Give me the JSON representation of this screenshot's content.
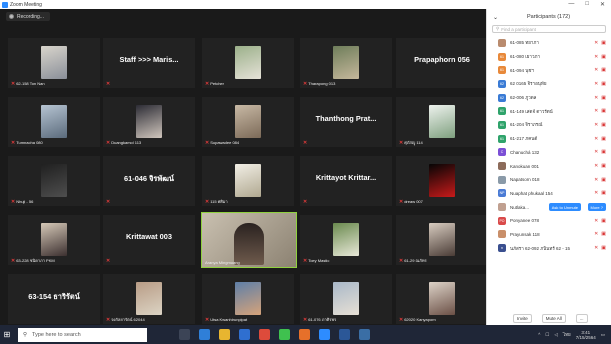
{
  "window": {
    "title": "Zoom Meeting",
    "controls": [
      "—",
      "□",
      "✕"
    ]
  },
  "recording": {
    "label": "Recording..."
  },
  "tiles": [
    {
      "kind": "pic",
      "label": "62-158 Ton Nan",
      "c1": "#d9d5cc",
      "c2": "#8a8f99",
      "muted": true
    },
    {
      "kind": "text",
      "text": "Staff >>> Maris...",
      "label": "",
      "muted": true
    },
    {
      "kind": "pic",
      "label": "Petcher",
      "c1": "#9bb08a",
      "c2": "#e6e2d8",
      "muted": true
    },
    {
      "kind": "pic",
      "label": "Tharapong 013",
      "c1": "#6e7d5a",
      "c2": "#c6b89c",
      "muted": true
    },
    {
      "kind": "text",
      "text": "Prapaphorn 056",
      "label": "",
      "muted": false
    },
    {
      "kind": "pic",
      "label": "Tumnacha 080",
      "c1": "#b6c4d2",
      "c2": "#5b6b7c",
      "muted": true
    },
    {
      "kind": "pic",
      "label": "Duangkamol 113",
      "c1": "#2c2c35",
      "c2": "#d0c6bd",
      "muted": true
    },
    {
      "kind": "pic",
      "label": "Supawadee 084",
      "c1": "#c8b9a5",
      "c2": "#7c6a58",
      "muted": true
    },
    {
      "kind": "text",
      "text": "Thanthong Prat...",
      "label": "",
      "muted": true
    },
    {
      "kind": "pic",
      "label": "ศุภัสญู 114",
      "c1": "#eef2ee",
      "c2": "#7fa07f",
      "muted": true
    },
    {
      "kind": "pic",
      "label": "Nhuji - 56",
      "c1": "#202020",
      "c2": "#4e4e4e",
      "muted": true
    },
    {
      "kind": "text",
      "text": "61-046 จิรพัฒน์",
      "label": "",
      "muted": true
    },
    {
      "kind": "pic",
      "label": "115 ศศิมา",
      "c1": "#f2efe6",
      "c2": "#b0a890",
      "muted": true
    },
    {
      "kind": "text",
      "text": "Krittayot Krittar...",
      "label": "",
      "muted": true
    },
    {
      "kind": "pic",
      "label": "dreaw 007",
      "c1": "#050505",
      "c2": "#c81a1a",
      "muted": true
    },
    {
      "kind": "pic",
      "label": "63-228 ชนิดาภา PKM",
      "c1": "#d6c9b8",
      "c2": "#3c3030",
      "muted": true
    },
    {
      "kind": "text",
      "text": "Krittawat 003",
      "label": "",
      "muted": true
    },
    {
      "kind": "active",
      "label": "Aranya Mingmuang",
      "muted": false
    },
    {
      "kind": "pic",
      "label": "Toey Mastic",
      "c1": "#6a8a4e",
      "c2": "#e8e8d8",
      "muted": true
    },
    {
      "kind": "pic",
      "label": "61-29 ณภัทร",
      "c1": "#d8ccc0",
      "c2": "#4a3c36",
      "muted": true
    },
    {
      "kind": "text",
      "text": "63-154 ธาริรัตน์",
      "label": "",
      "muted": false
    },
    {
      "kind": "pic",
      "label": "จงกัลยารัตน์ 62044",
      "c1": "#b89c86",
      "c2": "#dcd4c4",
      "muted": true
    },
    {
      "kind": "pic",
      "label": "Utsa Kwanhirunpipat",
      "c1": "#5e7fa8",
      "c2": "#d6a37a",
      "muted": true
    },
    {
      "kind": "pic",
      "label": "61-076 ภาศิรพร",
      "c1": "#a9b8c8",
      "c2": "#e7e0d5",
      "muted": true
    },
    {
      "kind": "pic",
      "label": "62020 Kanyaporn",
      "c1": "#ddd3c8",
      "c2": "#6b5046",
      "muted": true
    }
  ],
  "panel": {
    "title": "Participants (172)",
    "search_placeholder": "Find a participant",
    "participants": [
      {
        "name": "61-085 ทยาภา",
        "av": "",
        "color": "#b98b6e"
      },
      {
        "name": "61-080 เยาวภา",
        "av": "61",
        "color": "#e8893a"
      },
      {
        "name": "61-094 นุชฯ",
        "av": "61",
        "color": "#e8893a"
      },
      {
        "name": "62 0165 จิราอนุทัย",
        "av": "62",
        "color": "#3a7bd5"
      },
      {
        "name": "62-006 ภูวดล",
        "av": "62",
        "color": "#3a7bd5"
      },
      {
        "name": "61-149 เสดจ์ ดาวรัตน์",
        "av": "61",
        "color": "#2fa36b"
      },
      {
        "name": "61-204 จิราภรณ์",
        "av": "61",
        "color": "#2fa36b"
      },
      {
        "name": "61-217 ภคนต์",
        "av": "61",
        "color": "#2fa36b"
      },
      {
        "name": "Chanuchá 132",
        "av": "C",
        "color": "#7b4fd6"
      },
      {
        "name": "Kanokuan 001",
        "av": "",
        "color": "#8c6b5a"
      },
      {
        "name": "Napatsorn 018",
        "av": "",
        "color": "#8a9aa8"
      },
      {
        "name": "Nuaphat phukaal 154",
        "av": "NP",
        "color": "#4a7bd5"
      },
      {
        "name": "Nutlaka...",
        "av": "",
        "color": "#c0a090"
      },
      {
        "name": "Ponyanee 078",
        "av": "PO",
        "color": "#d94a4a"
      },
      {
        "name": "Prayunsak 118",
        "av": "",
        "color": "#c98f6a"
      },
      {
        "name": "นภัสรา 62-092 ภนินทร์ 62 - 15",
        "av": "n",
        "color": "#3a4f8f"
      }
    ],
    "ask_unmute": "Ask to Unmute",
    "more": "More ?",
    "invite": "Invite",
    "mute_all": "Mute All",
    "more_dots": "..."
  },
  "taskbar": {
    "search_placeholder": "Type here to search",
    "time": "3:41",
    "date": "7/15/2564",
    "lang": "ไทย"
  }
}
